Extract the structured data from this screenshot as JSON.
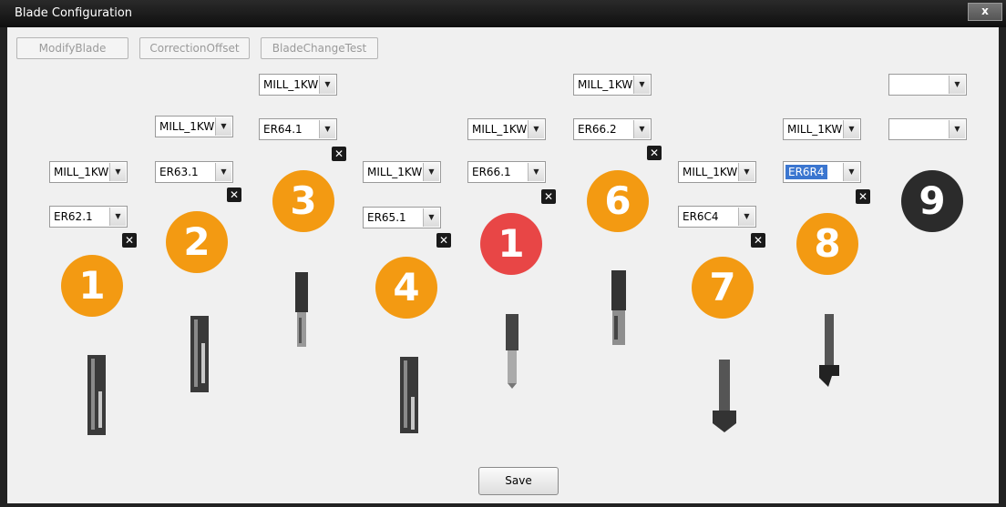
{
  "window": {
    "title": "Blade Configuration",
    "close_label": "x"
  },
  "toolbar": {
    "modify": "ModifyBlade",
    "correction": "CorrectionOffset",
    "change_test": "BladeChangeTest"
  },
  "colors": {
    "active_badge": "#f39a12",
    "current_badge": "#e84646",
    "empty_badge": "#2b2b2b"
  },
  "slots": [
    {
      "motor": "MILL_1KW",
      "blade": "ER62.1",
      "badge": "1"
    },
    {
      "motor": "MILL_1KW",
      "blade": "ER63.1",
      "badge": "2"
    },
    {
      "motor": "MILL_1KW",
      "blade": "ER64.1",
      "badge": "3"
    },
    {
      "motor": "MILL_1KW",
      "blade": "ER65.1",
      "badge": "4"
    },
    {
      "motor": "MILL_1KW",
      "blade": "ER66.1",
      "badge": "1"
    },
    {
      "motor": "MILL_1KW",
      "blade": "ER66.2",
      "badge": "6"
    },
    {
      "motor": "MILL_1KW",
      "blade": "ER6C4",
      "badge": "7"
    },
    {
      "motor": "MILL_1KW",
      "blade": "ER6R4",
      "badge": "8"
    },
    {
      "motor": "",
      "blade": "",
      "badge": "9"
    }
  ],
  "remove_label": "✕",
  "dropdown_arrow": "▼",
  "save_label": "Save"
}
